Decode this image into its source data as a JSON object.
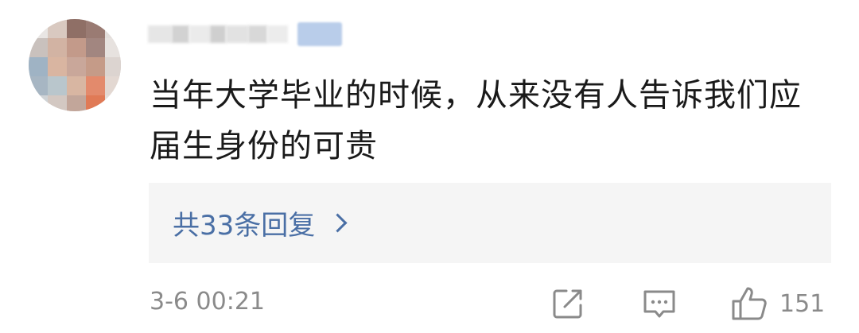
{
  "comment": {
    "text": "当年大学毕业的时候，从来没有人告诉我们应届生身份的可贵",
    "replies_link": "共33条回复",
    "timestamp": "3-6 00:21",
    "like_count": "151"
  },
  "icons": {
    "share": "share-icon",
    "reply": "comment-icon",
    "like": "thumbs-up-icon",
    "chevron": "chevron-right-icon"
  },
  "colors": {
    "link": "#4a6fa5",
    "reply_box_bg": "#f5f5f5",
    "meta_text": "#8a8a8a"
  }
}
